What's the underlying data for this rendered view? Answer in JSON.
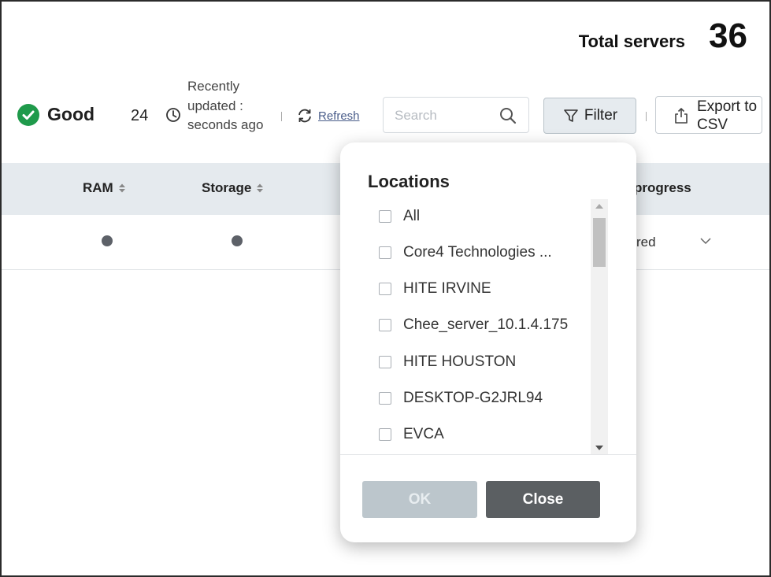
{
  "summary": {
    "total_label": "Total servers",
    "total_value": "36"
  },
  "status": {
    "good_label": "Good",
    "good_count": "24",
    "updated_text": "Recently updated : seconds ago",
    "refresh_label": "Refresh"
  },
  "toolbar": {
    "search_placeholder": "Search",
    "filter_label": "Filter",
    "export_label": "Export to CSV"
  },
  "table": {
    "headers": {
      "ram": "RAM",
      "storage": "Storage",
      "progress": "progress"
    },
    "rows": [
      {
        "status_text": "red"
      }
    ]
  },
  "filter_popup": {
    "title": "Locations",
    "items": [
      {
        "label": "All",
        "checked": false
      },
      {
        "label": "Core4 Technologies ...",
        "checked": false
      },
      {
        "label": "HITE IRVINE",
        "checked": false
      },
      {
        "label": "Chee_server_10.1.4.175",
        "checked": false
      },
      {
        "label": "HITE HOUSTON",
        "checked": false
      },
      {
        "label": "DESKTOP-G2JRL94",
        "checked": false
      },
      {
        "label": "EVCA",
        "checked": false
      }
    ],
    "ok_label": "OK",
    "close_label": "Close"
  },
  "colors": {
    "good_green": "#1f9a4b",
    "header_bg": "#e5eaee",
    "close_button": "#5b5f62",
    "ok_disabled": "#bcc6cc",
    "refresh_link": "#4a5d8a"
  }
}
